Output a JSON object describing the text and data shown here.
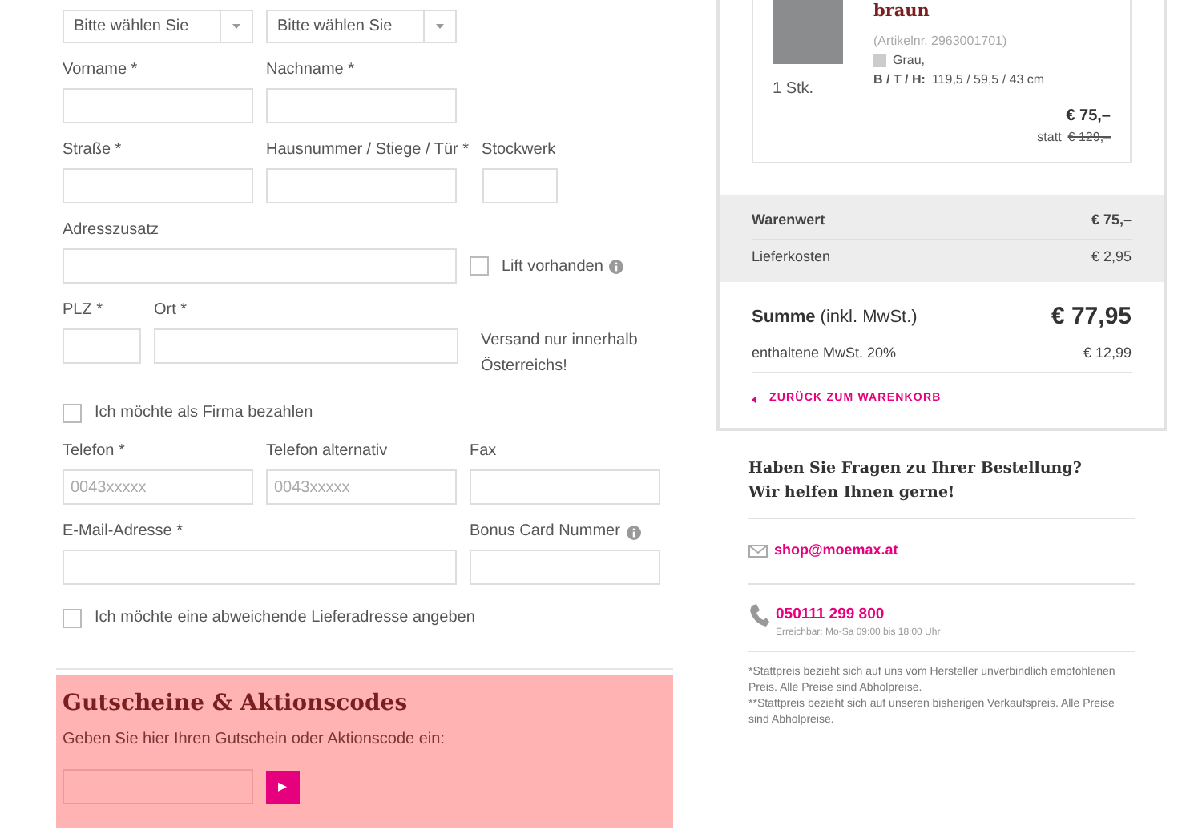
{
  "form": {
    "selects": [
      {
        "value": "Bitte wählen Sie"
      },
      {
        "value": "Bitte wählen Sie"
      }
    ],
    "rows": [
      {
        "items": [
          {
            "kind": "input",
            "label": "Vorname *"
          },
          {
            "kind": "input",
            "label": "Nachname *"
          }
        ]
      },
      {
        "items": [
          {
            "kind": "input",
            "label": "Straße *"
          },
          {
            "kind": "input",
            "label": "Hausnummer / Stiege / Tür *"
          },
          {
            "kind": "input",
            "label": "Stockwerk"
          }
        ]
      },
      {
        "items": [
          {
            "kind": "input",
            "label": "Adresszusatz"
          },
          {
            "kind": "checkbox",
            "label": "Lift vorhanden",
            "checked": false,
            "info": true
          }
        ]
      },
      {
        "items": [
          {
            "kind": "input",
            "label": "PLZ *"
          },
          {
            "kind": "input",
            "label": "Ort *"
          },
          {
            "kind": "note",
            "text": "Versand nur innerhalb Österreichs!"
          }
        ]
      },
      {
        "items": [
          {
            "kind": "checkbox",
            "label": "Ich möchte als Firma bezahlen",
            "checked": false
          }
        ]
      },
      {
        "items": [
          {
            "kind": "input",
            "label": "Telefon *",
            "placeholder": "0043xxxxx"
          },
          {
            "kind": "input",
            "label": "Telefon alternativ",
            "placeholder": "0043xxxxx"
          },
          {
            "kind": "input",
            "label": "Fax"
          }
        ]
      },
      {
        "items": [
          {
            "kind": "input",
            "label": "E-Mail-Adresse *"
          },
          {
            "kind": "input",
            "label": "Bonus Card Nummer",
            "info": true
          }
        ]
      },
      {
        "items": [
          {
            "kind": "checkbox",
            "label": "Ich möchte eine abweichende Lieferadresse angeben",
            "checked": false
          }
        ]
      }
    ]
  },
  "voucher": {
    "title": "Gutscheine & Aktionscodes",
    "text": "Geben Sie hier Ihren Gutschein oder Aktionscode ein:",
    "button": "▸"
  },
  "cart_item": {
    "title": "braun",
    "quantity": "1 Stk.",
    "article_no": "(Artikelnr. 2963001701)",
    "color_label": "Grau,",
    "dimensions_label": "B / T / H:",
    "dimensions": "119,5 / 59,5 / 43 cm",
    "price": "€ 75,–",
    "old_price_prefix": "statt",
    "old_price": "€ 129,–"
  },
  "summary": {
    "rows": [
      {
        "label": "Warenwert",
        "value": "€ 75,–"
      },
      {
        "label": "Lieferkosten",
        "value": "€ 2,95"
      }
    ],
    "total": {
      "label": "**Summe** (inkl. MwSt.)",
      "value": "€ 77,95"
    },
    "vat": {
      "label": "enthaltene MwSt. 20%",
      "value": "€ 12,99"
    },
    "back_link": "ZURÜCK ZUM WARENKORB"
  },
  "help": {
    "title": "Haben Sie Fragen zu Ihrer Bestellung?",
    "subtitle": "Wir helfen Ihnen gerne!",
    "email": "shop@moemax.at",
    "phone": "050111 299 800",
    "hours": "Erreichbar: Mo-Sa 09:00 bis 18:00 Uhr"
  },
  "footnotes": [
    "*Stattpreis bezieht sich auf uns vom Hersteller unverbindlich empfohlenen Preis. Alle Preise sind Abholpreise.",
    "**Stattpreis bezieht sich auf unseren bisherigen Verkaufspreis. Alle Preise sind Abholpreise."
  ]
}
